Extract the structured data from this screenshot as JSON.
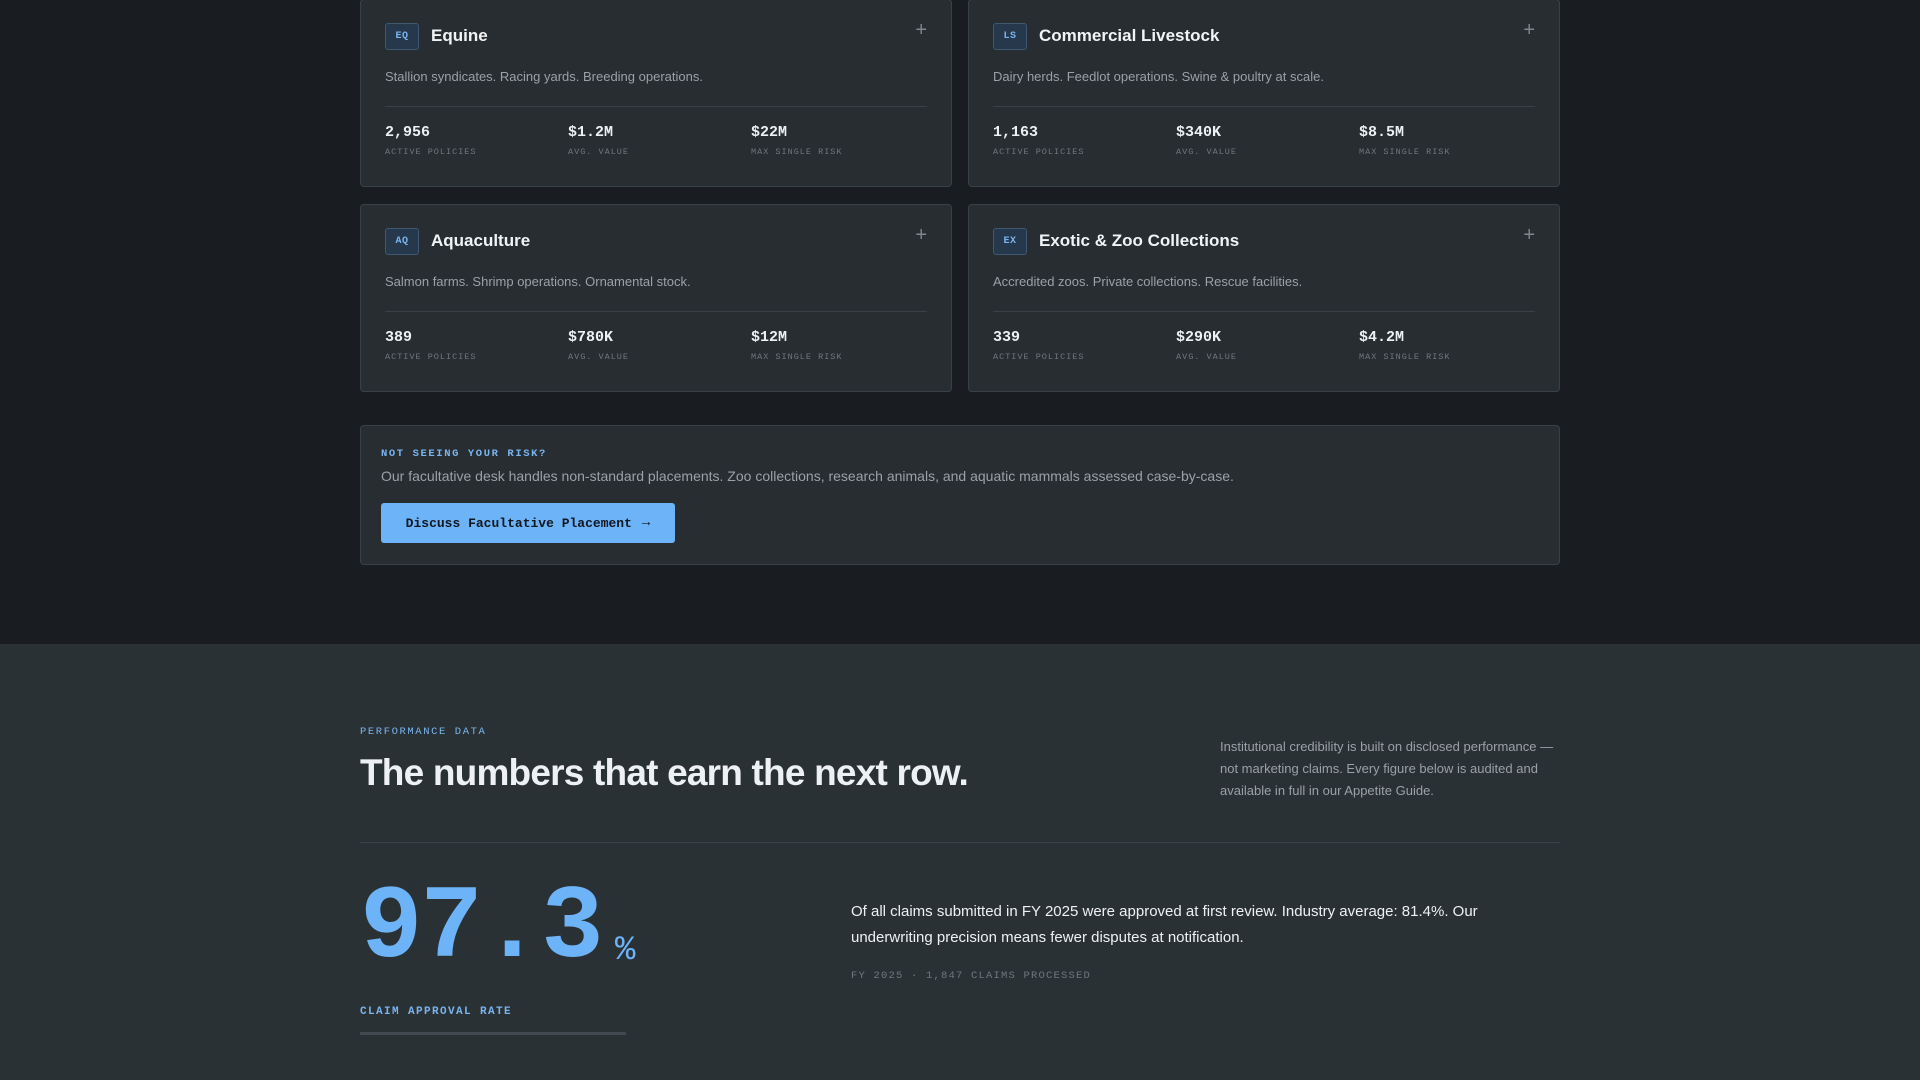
{
  "cards": [
    {
      "code": "EQ",
      "title": "Equine",
      "description": "Stallion syndicates. Racing yards. Breeding operations.",
      "stats": [
        {
          "value": "2,956",
          "label": "ACTIVE POLICIES"
        },
        {
          "value": "$1.2M",
          "label": "AVG. VALUE"
        },
        {
          "value": "$22M",
          "label": "MAX SINGLE RISK"
        }
      ]
    },
    {
      "code": "LS",
      "title": "Commercial Livestock",
      "description": "Dairy herds. Feedlot operations. Swine & poultry at scale.",
      "stats": [
        {
          "value": "1,163",
          "label": "ACTIVE POLICIES"
        },
        {
          "value": "$340K",
          "label": "AVG. VALUE"
        },
        {
          "value": "$8.5M",
          "label": "MAX SINGLE RISK"
        }
      ]
    },
    {
      "code": "AQ",
      "title": "Aquaculture",
      "description": "Salmon farms. Shrimp operations. Ornamental stock.",
      "stats": [
        {
          "value": "389",
          "label": "ACTIVE POLICIES"
        },
        {
          "value": "$780K",
          "label": "AVG. VALUE"
        },
        {
          "value": "$12M",
          "label": "MAX SINGLE RISK"
        }
      ]
    },
    {
      "code": "EX",
      "title": "Exotic & Zoo Collections",
      "description": "Accredited zoos. Private collections. Rescue facilities.",
      "stats": [
        {
          "value": "339",
          "label": "ACTIVE POLICIES"
        },
        {
          "value": "$290K",
          "label": "AVG. VALUE"
        },
        {
          "value": "$4.2M",
          "label": "MAX SINGLE RISK"
        }
      ]
    }
  ],
  "cta": {
    "eyebrow": "NOT SEEING YOUR RISK?",
    "text": "Our facultative desk handles non-standard placements. Zoo collections, research animals, and aquatic mammals assessed case-by-case.",
    "button_label": "Discuss Facultative Placement",
    "button_icon": "arrow-right-icon"
  },
  "performance": {
    "eyebrow": "PERFORMANCE DATA",
    "title": "The numbers that earn the next row.",
    "intro": "Institutional credibility is built on disclosed performance — not marketing claims. Every figure below is audited and available in full in our Appetite Guide.",
    "metric": {
      "value": "97.3",
      "unit": "%",
      "label": "CLAIM APPROVAL RATE",
      "description": "Of all claims submitted in FY 2025 were approved at first review. Industry average: 81.4%. Our underwriting precision means fewer disputes at notification.",
      "meta": "FY 2025 · 1,847 CLAIMS PROCESSED"
    }
  },
  "colors": {
    "accent": "#6db3f8",
    "background": "#191d21",
    "card": "#272d31",
    "section": "#2a3135"
  }
}
